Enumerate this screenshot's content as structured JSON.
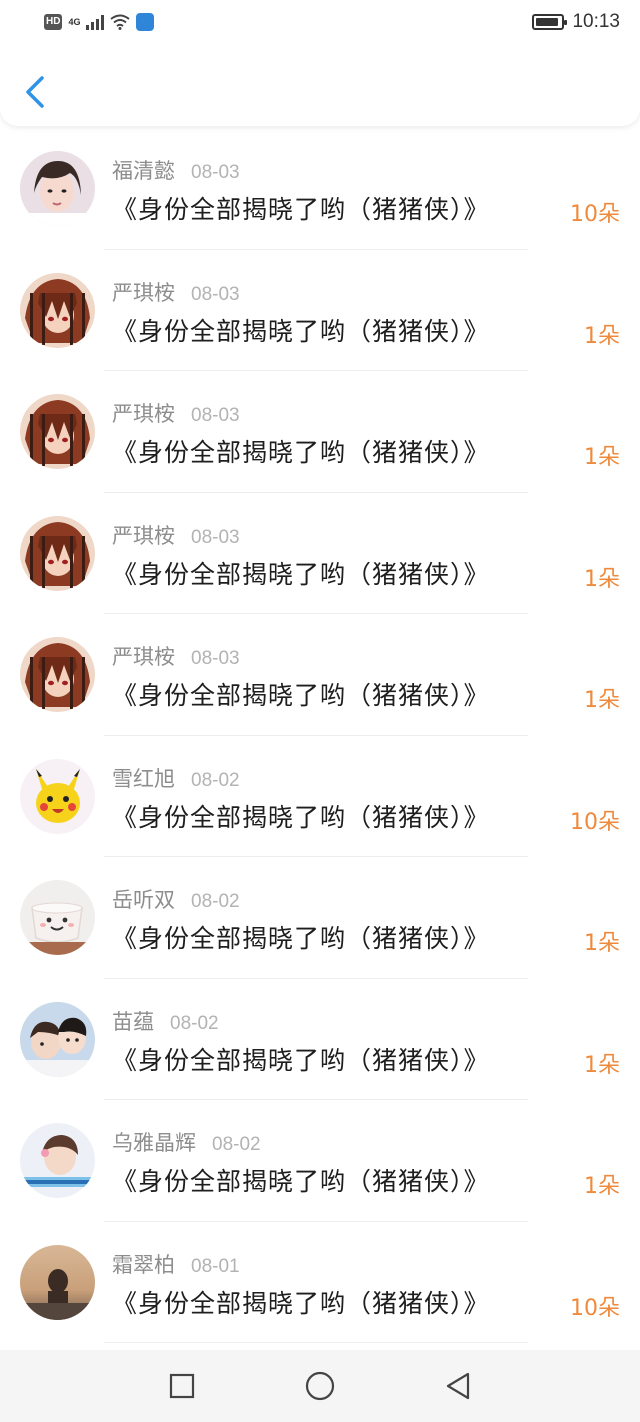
{
  "status_bar": {
    "hd": "HD",
    "network": "4G",
    "time": "10:13",
    "battery_level": 0.9
  },
  "colors": {
    "accent_orange": "#ef8a3c",
    "back_blue": "#2f93e6"
  },
  "list": [
    {
      "name": "福清懿",
      "date": "08-03",
      "title": "《身份全部揭晓了哟（猪猪侠）》",
      "amount": "10朵",
      "avatar": "girl-photo"
    },
    {
      "name": "严琪桉",
      "date": "08-03",
      "title": "《身份全部揭晓了哟（猪猪侠）》",
      "amount": "1朵",
      "avatar": "anime-character"
    },
    {
      "name": "严琪桉",
      "date": "08-03",
      "title": "《身份全部揭晓了哟（猪猪侠）》",
      "amount": "1朵",
      "avatar": "anime-character"
    },
    {
      "name": "严琪桉",
      "date": "08-03",
      "title": "《身份全部揭晓了哟（猪猪侠）》",
      "amount": "1朵",
      "avatar": "anime-character"
    },
    {
      "name": "严琪桉",
      "date": "08-03",
      "title": "《身份全部揭晓了哟（猪猪侠）》",
      "amount": "1朵",
      "avatar": "anime-character"
    },
    {
      "name": "雪红旭",
      "date": "08-02",
      "title": "《身份全部揭晓了哟（猪猪侠）》",
      "amount": "10朵",
      "avatar": "pikachu"
    },
    {
      "name": "岳听双",
      "date": "08-02",
      "title": "《身份全部揭晓了哟（猪猪侠）》",
      "amount": "1朵",
      "avatar": "smiley-cup"
    },
    {
      "name": "苗蕴",
      "date": "08-02",
      "title": "《身份全部揭晓了哟（猪猪侠）》",
      "amount": "1朵",
      "avatar": "kids-photo"
    },
    {
      "name": "乌雅晶辉",
      "date": "08-02",
      "title": "《身份全部揭晓了哟（猪猪侠）》",
      "amount": "1朵",
      "avatar": "girl-sticker"
    },
    {
      "name": "霜翠柏",
      "date": "08-01",
      "title": "《身份全部揭晓了哟（猪猪侠）》",
      "amount": "10朵",
      "avatar": "sunset-photo"
    }
  ],
  "nav": {
    "recent": "square-icon",
    "home": "circle-icon",
    "back": "triangle-back-icon"
  }
}
